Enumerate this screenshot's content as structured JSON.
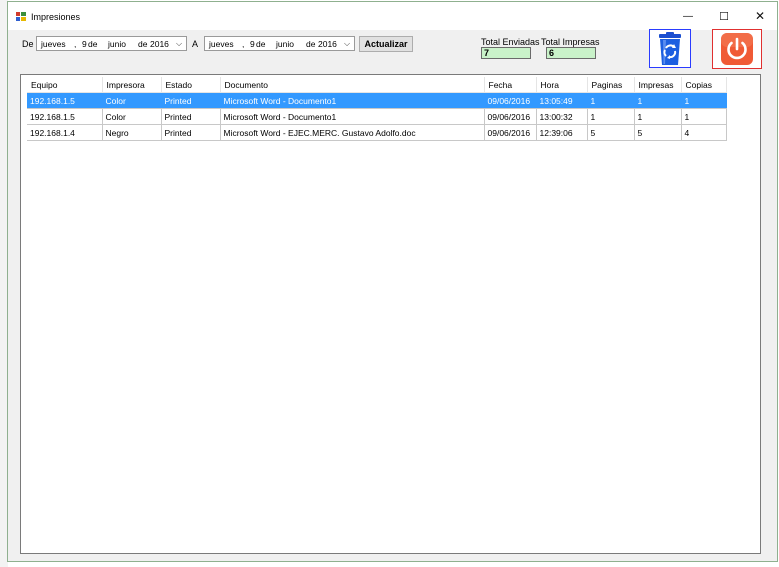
{
  "window": {
    "title": "Impresiones"
  },
  "controls": {
    "minimize": "—",
    "maximize": "☐",
    "close": "✕"
  },
  "filters": {
    "from_label": "De",
    "to_label": "A",
    "from_date": {
      "weekday": "jueves",
      "sep": ",",
      "day": "9",
      "de1": "de",
      "month": "junio",
      "de2": "de",
      "year": "2016"
    },
    "to_date": {
      "weekday": "jueves",
      "sep": ",",
      "day": "9",
      "de1": "de",
      "month": "junio",
      "de2": "de",
      "year": "2016"
    },
    "refresh_label": "Actualizar"
  },
  "totals": {
    "sent_label": "Total Enviadas",
    "sent_value": "7",
    "printed_label": "Total Impresas",
    "printed_value": "6"
  },
  "icons": {
    "recycle": "recycle-bin-icon",
    "power": "power-icon"
  },
  "colors": {
    "selection": "#3399ff",
    "totals_bg": "#c9f2c9",
    "recycle_border": "#2a3cff",
    "power_border": "#e03030",
    "power_fill": "#f05a35"
  },
  "table": {
    "columns": [
      "Equipo",
      "Impresora",
      "Estado",
      "Documento",
      "Fecha",
      "Hora",
      "Paginas",
      "Impresas",
      "Copias"
    ],
    "rows": [
      [
        "192.168.1.5",
        "Color",
        "Printed",
        "Microsoft Word - Documento1",
        "09/06/2016",
        "13:05:49",
        "1",
        "1",
        "1"
      ],
      [
        "192.168.1.5",
        "Color",
        "Printed",
        "Microsoft Word - Documento1",
        "09/06/2016",
        "13:00:32",
        "1",
        "1",
        "1"
      ],
      [
        "192.168.1.4",
        "Negro",
        "Printed",
        "Microsoft Word - EJEC.MERC. Gustavo Adolfo.doc",
        "09/06/2016",
        "12:39:06",
        "5",
        "5",
        "4"
      ]
    ],
    "selected_row": 0
  }
}
